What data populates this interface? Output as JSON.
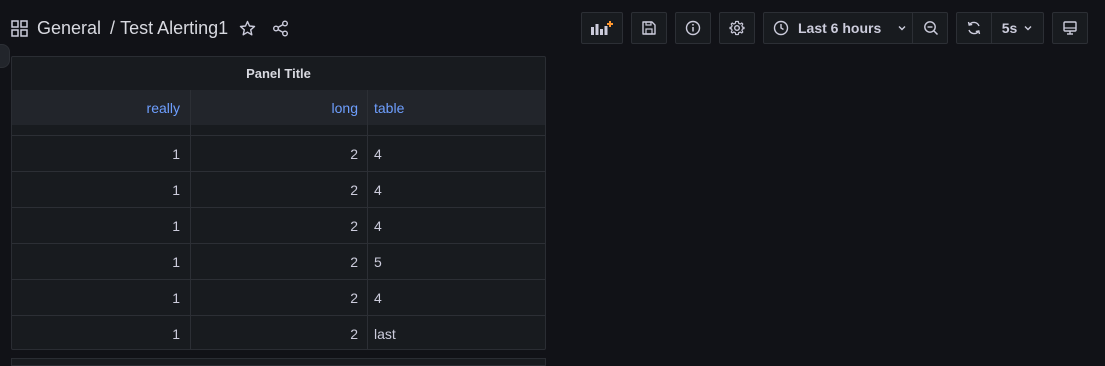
{
  "header": {
    "folder": "General",
    "separator": "/",
    "dashboard_title": "Test Alerting1"
  },
  "toolbar": {
    "add_panel_icon": "add-panel-icon",
    "save_icon": "save-icon",
    "info_icon": "info-icon",
    "settings_icon": "gear-icon",
    "time_range_label": "Last 6 hours",
    "refresh_interval_label": "5s",
    "tv_mode_icon": "tv-monitor-icon",
    "accent_color": "#ff9830"
  },
  "panel": {
    "title": "Panel Title",
    "columns": [
      "really",
      "long",
      "table"
    ],
    "rows": [
      [
        "",
        "",
        ""
      ],
      [
        "1",
        "2",
        "4"
      ],
      [
        "1",
        "2",
        "4"
      ],
      [
        "1",
        "2",
        "4"
      ],
      [
        "1",
        "2",
        "5"
      ],
      [
        "1",
        "2",
        "4"
      ],
      [
        "1",
        "2",
        "last"
      ]
    ],
    "header_color": "#6e9fff"
  }
}
